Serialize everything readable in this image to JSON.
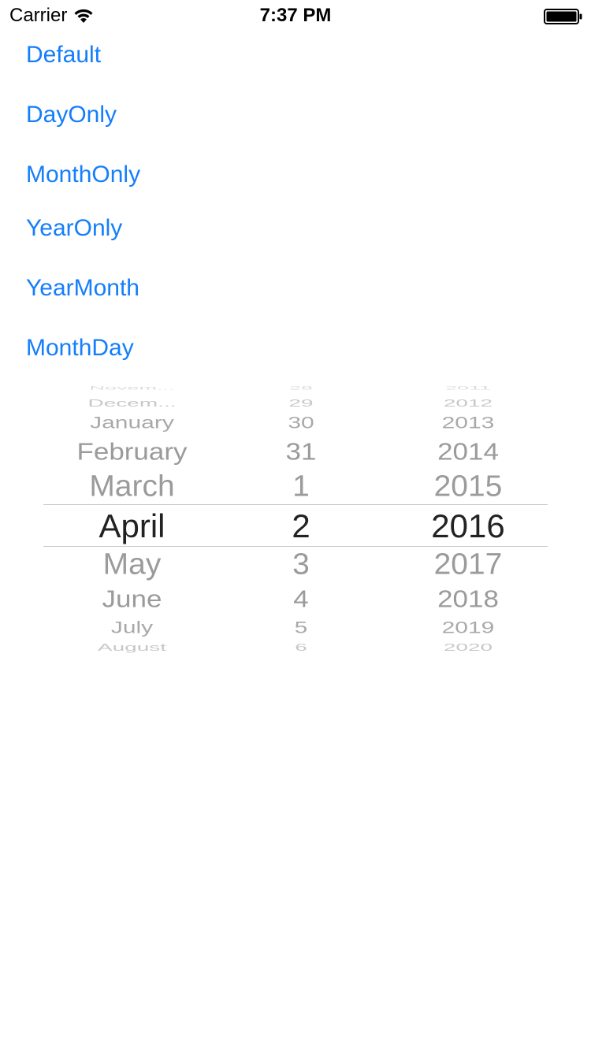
{
  "status_bar": {
    "carrier": "Carrier",
    "time": "7:37 PM",
    "icons": {
      "wifi": "wifi-icon",
      "battery": "battery-icon"
    }
  },
  "buttons": {
    "default": "Default",
    "day_only": "DayOnly",
    "month_only": "MonthOnly",
    "year_only": "YearOnly",
    "year_month": "YearMonth",
    "month_day": "MonthDay"
  },
  "accent_color": "#147efb",
  "picker": {
    "months": [
      "Novem...",
      "Decem...",
      "January",
      "February",
      "March",
      "April",
      "May",
      "June",
      "July",
      "August"
    ],
    "days": [
      "28",
      "29",
      "30",
      "31",
      "1",
      "2",
      "3",
      "4",
      "5",
      "6"
    ],
    "years": [
      "2011",
      "2012",
      "2013",
      "2014",
      "2015",
      "2016",
      "2017",
      "2018",
      "2019",
      "2020"
    ],
    "selected": {
      "month": "April",
      "day": "2",
      "year": "2016"
    }
  }
}
